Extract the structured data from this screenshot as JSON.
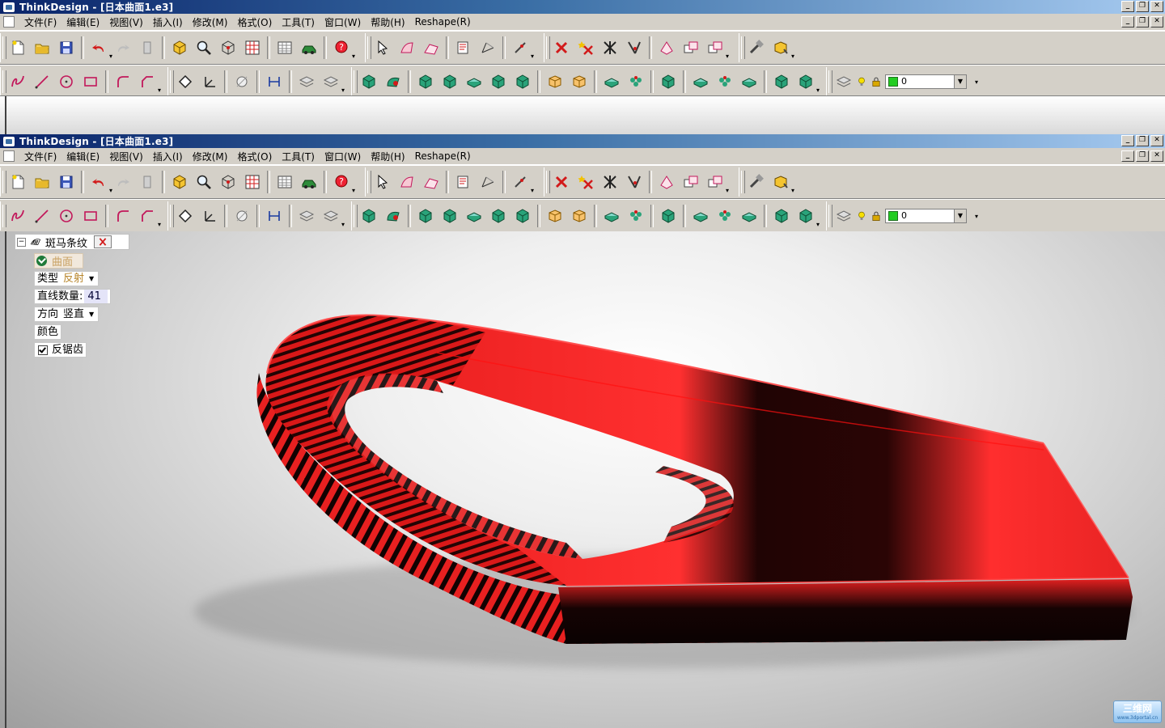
{
  "window": {
    "title": "ThinkDesign - [日本曲面1.e3]"
  },
  "menu": [
    "文件(F)",
    "编辑(E)",
    "视图(V)",
    "插入(I)",
    "修改(M)",
    "格式(O)",
    "工具(T)",
    "窗口(W)",
    "帮助(H)",
    "Reshape(R)"
  ],
  "layer": {
    "value": "0",
    "color": "#22cc22"
  },
  "panel": {
    "title": "斑马条纹",
    "surface_label": "曲面",
    "type_label": "类型",
    "type_value": "反射",
    "count_label": "直线数量:",
    "count_value": "41",
    "direction_label": "方向",
    "direction_value": "竖直",
    "color_label": "颜色",
    "antialias_label": "反锯齿",
    "antialias_checked": true
  },
  "watermark": {
    "text": "三维网",
    "sub": "www.3dportal.cn"
  }
}
